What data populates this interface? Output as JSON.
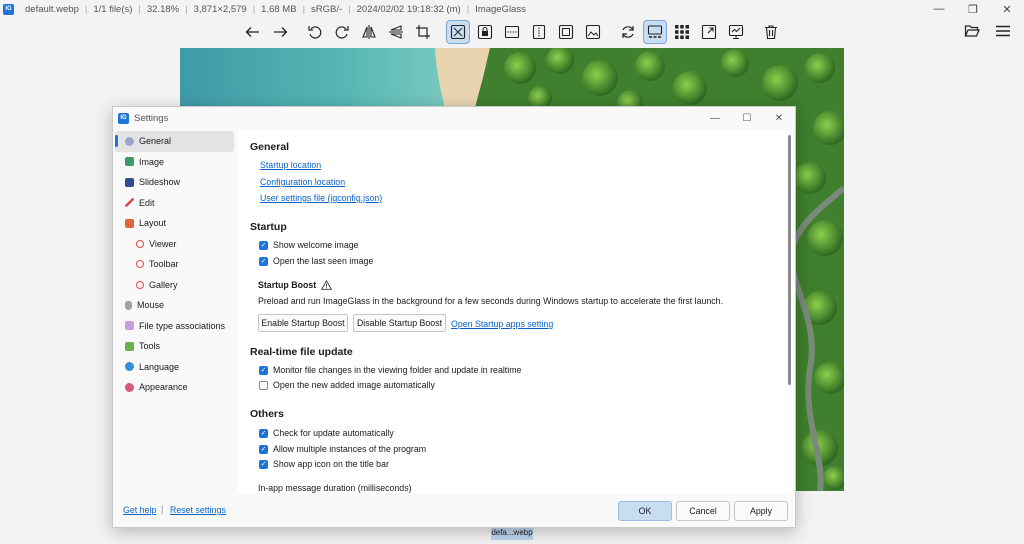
{
  "window": {
    "logo_text": "IG",
    "title_parts": [
      "default.webp",
      "1/1 file(s)",
      "32.18%",
      "3,871×2,579",
      "1.68 MB",
      "sRGB/-",
      "2024/02/02 19:18:32 (m)",
      "ImageGlass"
    ],
    "controls": [
      "—",
      "❐",
      "✕"
    ]
  },
  "toolbar": {
    "icons": [
      "arrow-left-icon",
      "arrow-right-icon",
      "rotate-left-icon",
      "rotate-right-icon",
      "flip-horizontal-icon",
      "flip-vertical-icon",
      "crop-icon",
      "auto-zoom-icon",
      "lock-zoom-icon",
      "scale-to-width-icon",
      "scale-to-height-icon",
      "scale-to-fit-icon",
      "scale-to-fill-icon",
      "refresh-icon",
      "toggle-gallery-icon",
      "toggle-thumbnail-icon",
      "fullscreen-icon",
      "slideshow-icon",
      "delete-icon"
    ],
    "active": [
      "auto-zoom-icon",
      "toggle-gallery-icon"
    ],
    "right_icons": [
      "open-folder-icon",
      "menu-icon"
    ]
  },
  "thumbnail_label": "defa...webp",
  "dialog": {
    "title": "Settings",
    "controls": [
      "—",
      "☐",
      "✕"
    ],
    "nav": [
      {
        "label": "General",
        "selected": true,
        "color": "#9aa7c8",
        "sub": false
      },
      {
        "label": "Image",
        "selected": false,
        "color": "#3d9b6a",
        "sub": false
      },
      {
        "label": "Slideshow",
        "selected": false,
        "color": "#2f4f8f",
        "sub": false
      },
      {
        "label": "Edit",
        "selected": false,
        "color": "#d84a4a",
        "sub": false
      },
      {
        "label": "Layout",
        "selected": false,
        "color": "#e0643c",
        "sub": false
      },
      {
        "label": "Viewer",
        "selected": false,
        "color": "#e04848",
        "sub": true
      },
      {
        "label": "Toolbar",
        "selected": false,
        "color": "#e04848",
        "sub": true
      },
      {
        "label": "Gallery",
        "selected": false,
        "color": "#e04848",
        "sub": true
      },
      {
        "label": "Mouse",
        "selected": false,
        "color": "#a0a0a0",
        "sub": false
      },
      {
        "label": "File type associations",
        "selected": false,
        "color": "#c8a0d8",
        "sub": false
      },
      {
        "label": "Tools",
        "selected": false,
        "color": "#6ab04c",
        "sub": false
      },
      {
        "label": "Language",
        "selected": false,
        "color": "#2f8fd8",
        "sub": false
      },
      {
        "label": "Appearance",
        "selected": false,
        "color": "#d85a7a",
        "sub": false
      }
    ],
    "general": {
      "title": "General",
      "links": [
        "Startup location",
        "Configuration location",
        "User settings file (igconfig.json)"
      ]
    },
    "startup": {
      "title": "Startup",
      "checks": [
        {
          "label": "Show welcome image",
          "checked": true
        },
        {
          "label": "Open the last seen image",
          "checked": true
        }
      ],
      "boost_title": "Startup Boost",
      "boost_icon": "warning-icon",
      "boost_desc": "Preload and run ImageGlass in the background for a few seconds during Windows startup to accelerate the first launch.",
      "enable_btn": "Enable Startup Boost",
      "disable_btn": "Disable Startup Boost",
      "apps_link": "Open Startup apps setting"
    },
    "realtime": {
      "title": "Real-time file update",
      "checks": [
        {
          "label": "Monitor file changes in the viewing folder and update in realtime",
          "checked": true
        },
        {
          "label": "Open the new added image automatically",
          "checked": false
        }
      ]
    },
    "others": {
      "title": "Others",
      "checks": [
        {
          "label": "Check for update automatically",
          "checked": true
        },
        {
          "label": "Allow multiple instances of the program",
          "checked": true
        },
        {
          "label": "Show app icon on the title bar",
          "checked": true
        }
      ],
      "duration_label": "In-app message duration (milliseconds)"
    },
    "footer": {
      "help": "Get help",
      "sep": "|",
      "reset": "Reset settings",
      "ok": "OK",
      "cancel": "Cancel",
      "apply": "Apply"
    }
  }
}
